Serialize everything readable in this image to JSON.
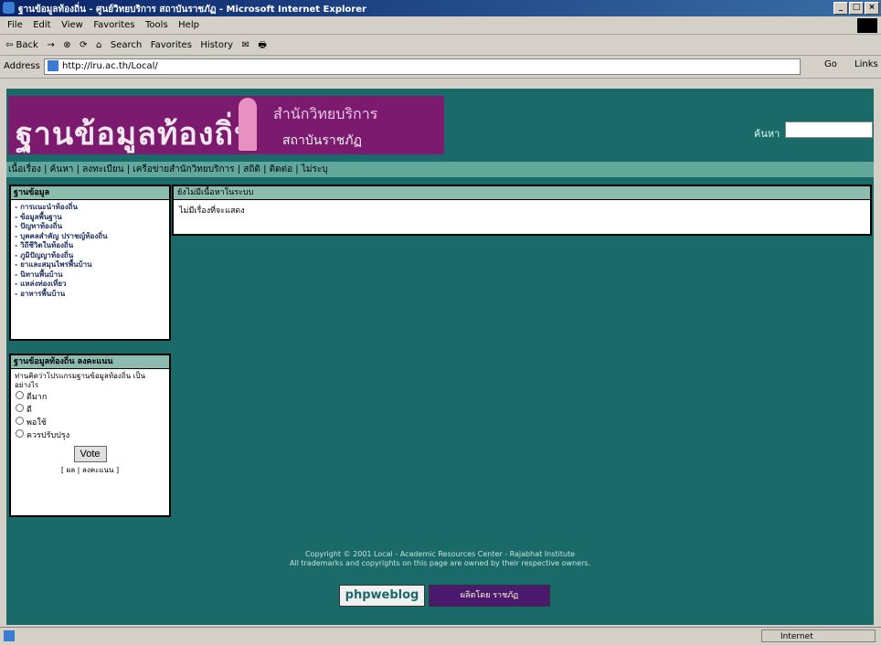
{
  "window": {
    "title": "ฐานข้อมูลท้องถิ่น - ศูนย์วิทยบริการ สถาบันราชภัฏ - Microsoft Internet Explorer",
    "min": "_",
    "max": "□",
    "close": "×"
  },
  "menu": [
    "File",
    "Edit",
    "View",
    "Favorites",
    "Tools",
    "Help"
  ],
  "toolbar": [
    "⇦ Back",
    "→",
    "⊗",
    "⟳",
    "⌂",
    "Search",
    "Favorites",
    "History",
    "✉",
    "🖶"
  ],
  "address": {
    "label": "Address",
    "url": "http://lru.ac.th/Local/",
    "go": "Go",
    "links": "Links"
  },
  "site": {
    "logo_title": "ฐานข้อมูลท้องถิ่น",
    "logo_org": "สำนักวิทยบริการ",
    "logo_inst": "สถาบันราชภัฏ",
    "search_label": "ค้นหา",
    "nav": "เนื้อเรื่อง | ค้นหา | ลงทะเบียน | เครือข่ายสำนักวิทยบริการ | สถิติ | ติดต่อ | ไม่ระบุ"
  },
  "sidebar": {
    "menu_title": "ฐานข้อมูล",
    "items": [
      "การแนะนำท้องถิ่น",
      "ข้อมูลพื้นฐาน",
      "ปัญหาท้องถิ่น",
      "บุคคลสำคัญ ปราชญ์ท้องถิ่น",
      "วิถีชีวิตในท้องถิ่น",
      "ภูมิปัญญาท้องถิ่น",
      "ยาและสมุนไพรพื้นบ้าน",
      "นิทานพื้นบ้าน",
      "แหล่งท่องเที่ยว",
      "อาหารพื้นบ้าน"
    ],
    "poll_title": "ฐานข้อมูลท้องถิ่น ลงคะแนน",
    "poll_question": "ท่านคิดว่าโปรแกรมฐานข้อมูลท้องถิ่น เป็นอย่างไร",
    "poll_options": [
      "ดีมาก",
      "ดี",
      "พอใช้",
      "ควรปรับปรุง"
    ],
    "vote_label": "Vote",
    "poll_links": "[ ผล | ลงคะแนน ]"
  },
  "main": {
    "box_title": "ยังไม่มีเนื้อหาในระบบ",
    "message": "ไม่มีเรื่องที่จะแสดง"
  },
  "footer": {
    "line1": "Copyright © 2001 Local - Academic Resources Center - Rajabhat Institute",
    "line2": "All trademarks and copyrights on this page are owned by their respective owners.",
    "badge1": "phpweblog",
    "badge2": "ผลิตโดย ราชภัฏ"
  },
  "status": {
    "zone": "Internet"
  }
}
